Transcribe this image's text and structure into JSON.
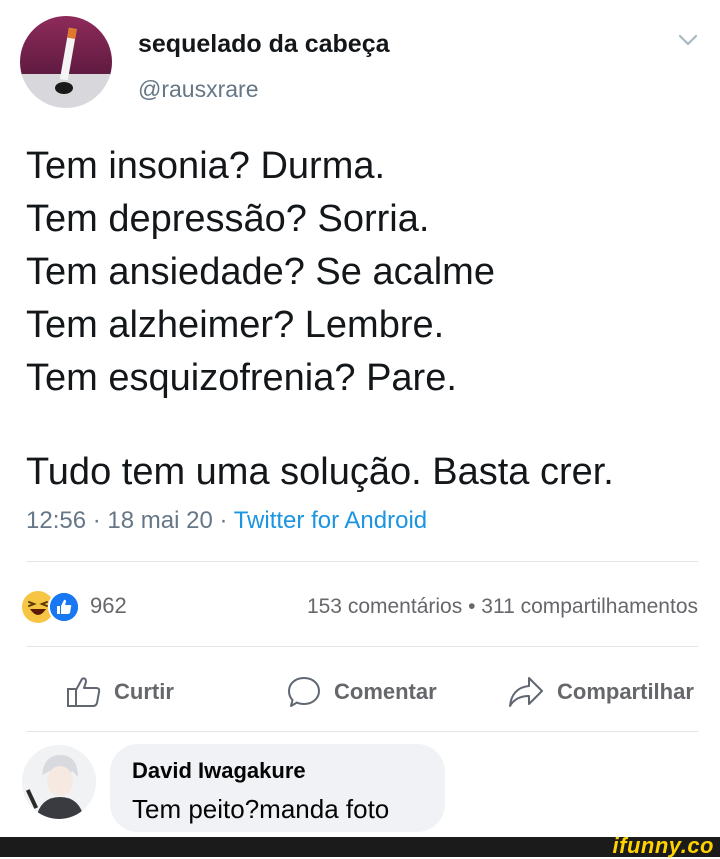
{
  "tweet": {
    "display_name": "sequelado da cabeça",
    "handle": "@rausxrare",
    "lines": [
      "Tem insonia? Durma.",
      "Tem depressão? Sorria.",
      "Tem ansiedade? Se acalme",
      "Tem alzheimer? Lembre.",
      "Tem esquizofrenia? Pare."
    ],
    "conclusion": "Tudo tem uma solução. Basta crer.",
    "time": "12:56",
    "date": "18 mai 20",
    "source": "Twitter for Android",
    "sep": "·"
  },
  "post": {
    "reaction_count": "962",
    "reaction_icons": [
      "haha-icon",
      "like-icon"
    ],
    "comments": "153 comentários",
    "shares": "311 compartilhamentos",
    "bullet": "•"
  },
  "actions": {
    "like": "Curtir",
    "comment": "Comentar",
    "share": "Compartilhar"
  },
  "comment": {
    "author": "David Iwagakure",
    "text": "Tem peito?manda foto"
  },
  "watermark": "ifunny.co",
  "colors": {
    "like_blue": "#1877f2",
    "haha_yellow": "#f7c544",
    "twitter_link": "#1b95e0",
    "watermark_yellow": "#ffd200"
  }
}
